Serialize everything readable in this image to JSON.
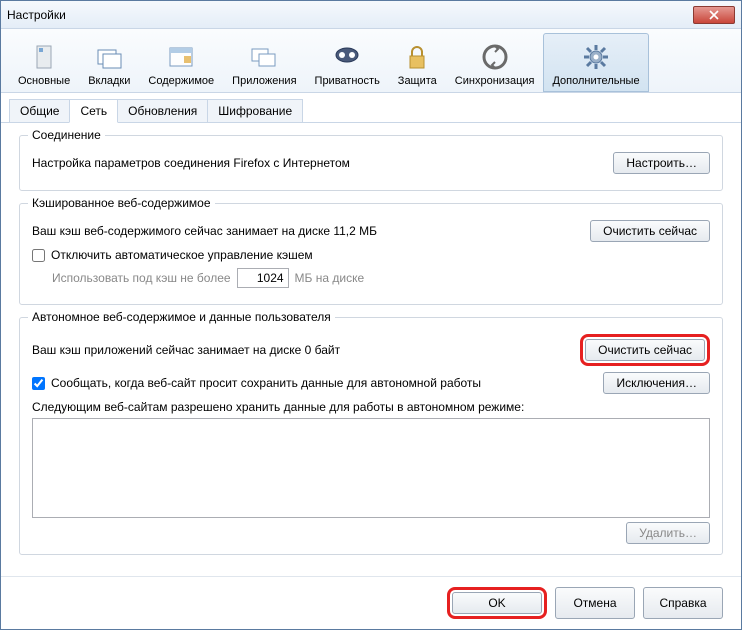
{
  "window": {
    "title": "Настройки"
  },
  "toolbar": [
    {
      "label": "Основные"
    },
    {
      "label": "Вкладки"
    },
    {
      "label": "Содержимое"
    },
    {
      "label": "Приложения"
    },
    {
      "label": "Приватность"
    },
    {
      "label": "Защита"
    },
    {
      "label": "Синхронизация"
    },
    {
      "label": "Дополнительные"
    }
  ],
  "tabs": [
    {
      "label": "Общие"
    },
    {
      "label": "Сеть"
    },
    {
      "label": "Обновления"
    },
    {
      "label": "Шифрование"
    }
  ],
  "connection": {
    "legend": "Соединение",
    "text": "Настройка параметров соединения Firefox с Интернетом",
    "button": "Настроить…"
  },
  "cache": {
    "legend": "Кэшированное веб-содержимое",
    "size_text": "Ваш кэш веб-содержимого сейчас занимает на диске 11,2 МБ",
    "clear": "Очистить сейчас",
    "disable_chk": "Отключить автоматическое управление кэшем",
    "use_upto": "Использовать под кэш не более",
    "value": "1024",
    "unit": "МБ на диске"
  },
  "offline": {
    "legend": "Автономное веб-содержимое и данные пользователя",
    "size_text": "Ваш кэш приложений сейчас занимает на диске 0 байт",
    "clear": "Очистить сейчас",
    "notify_chk": "Сообщать, когда веб-сайт просит сохранить данные для автономной работы",
    "exceptions": "Исключения…",
    "allowed_text": "Следующим веб-сайтам разрешено хранить данные для работы в автономном режиме:",
    "remove": "Удалить…"
  },
  "footer": {
    "ok": "OK",
    "cancel": "Отмена",
    "help": "Справка"
  }
}
